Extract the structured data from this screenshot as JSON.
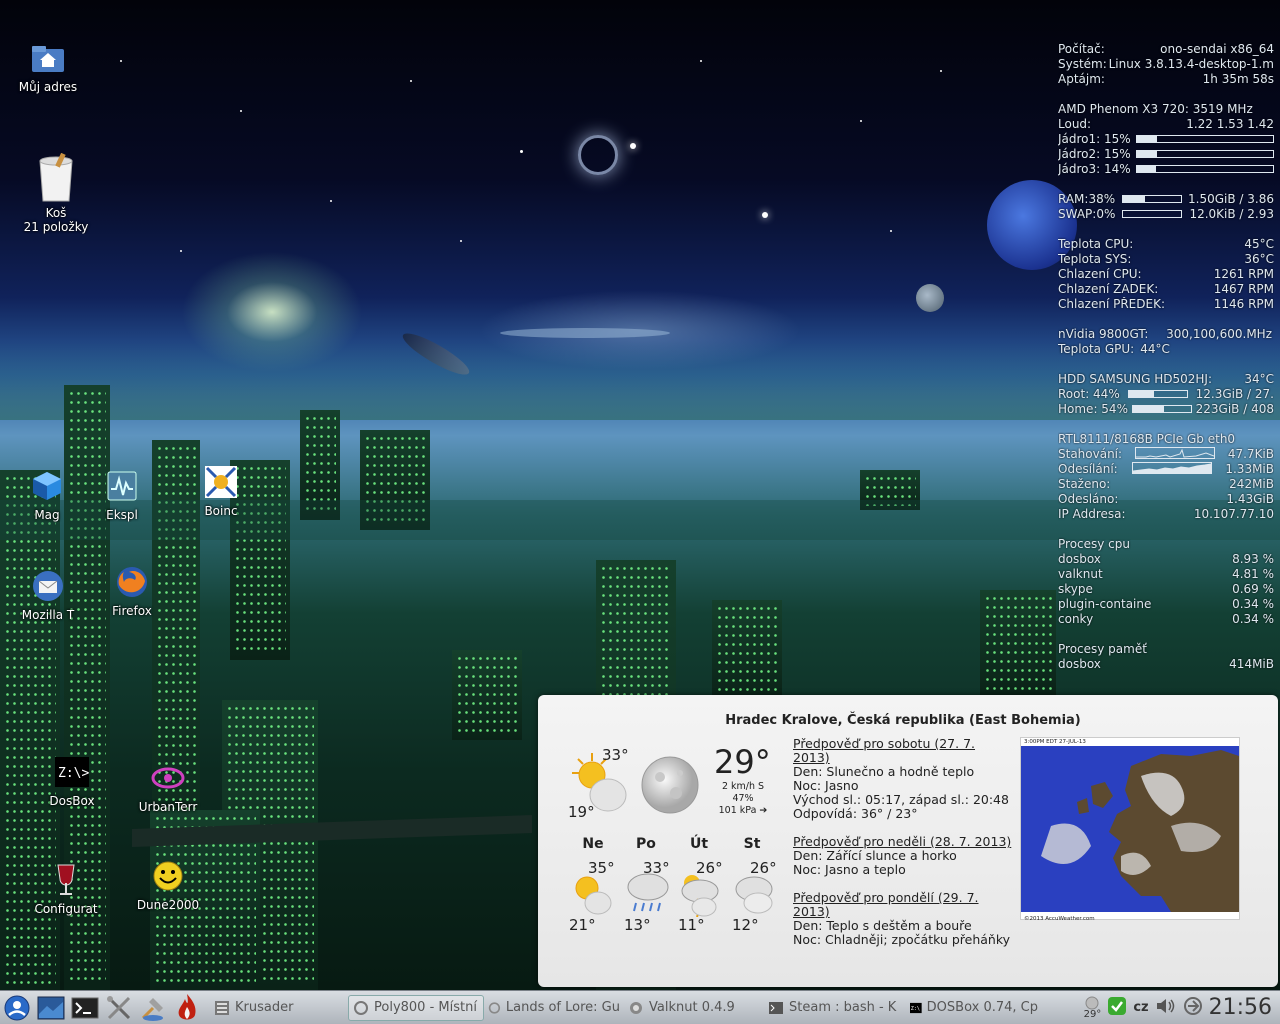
{
  "desktop": {
    "icons": [
      {
        "label": "Můj adres",
        "icon": "home-folder-icon"
      },
      {
        "label": "Koš",
        "sublabel": "21 položky",
        "icon": "trash-icon"
      },
      {
        "label": "Mag",
        "icon": "cube-icon"
      },
      {
        "label": "Ekspl",
        "icon": "monitor-icon"
      },
      {
        "label": "Boinc",
        "icon": "boinc-icon"
      },
      {
        "label": "Mozilla T",
        "icon": "thunderbird-icon"
      },
      {
        "label": "Firefox",
        "icon": "firefox-icon"
      },
      {
        "label": "DosBox",
        "icon": "dosbox-icon"
      },
      {
        "label": "UrbanTerr",
        "icon": "urbanterror-icon"
      },
      {
        "label": "Configurat",
        "icon": "wine-icon"
      },
      {
        "label": "Dune2000",
        "icon": "smiley-icon"
      }
    ]
  },
  "conky": {
    "sys": [
      {
        "l": "Počítač:",
        "r": "ono-sendai x86_64"
      },
      {
        "l": "Systém:",
        "r": "Linux 3.8.13.4-desktop-1.m"
      },
      {
        "l": "Aptájm:",
        "r": "1h 35m 58s"
      }
    ],
    "cpu_name": "AMD Phenom X3 720: 3519 MHz",
    "load": {
      "l": "Loud:",
      "r": "1.22 1.53 1.42"
    },
    "cores": [
      {
        "l": "Jádro1: 15%",
        "v": 0.15
      },
      {
        "l": "Jádro2: 15%",
        "v": 0.15
      },
      {
        "l": "Jádro3: 14%",
        "v": 0.14
      }
    ],
    "mem": [
      {
        "l": "RAM:38%",
        "v": 0.38,
        "r": "1.50GiB / 3.86"
      },
      {
        "l": "SWAP:0%",
        "v": 0.0,
        "r": "12.0KiB / 2.93"
      }
    ],
    "temps": [
      {
        "l": "Teplota CPU:",
        "r": "45°C"
      },
      {
        "l": "Teplota SYS:",
        "r": "36°C"
      },
      {
        "l": "Chlazení CPU:",
        "r": "1261 RPM"
      },
      {
        "l": "Chlazení ZADEK:",
        "r": "1467 RPM"
      },
      {
        "l": "Chlazení PŘEDEK:",
        "r": "1146 RPM"
      }
    ],
    "gpu": [
      {
        "l": "nVidia 9800GT:",
        "r": "300,100,600.MHz"
      },
      {
        "l": "Teplota GPU:",
        "r": "44°C"
      }
    ],
    "hdd": {
      "l": "HDD SAMSUNG HD502HJ:",
      "r": "34°C"
    },
    "disks": [
      {
        "l": "Root: 44%",
        "v": 0.44,
        "r": "12.3GiB / 27."
      },
      {
        "l": "Home: 54%",
        "v": 0.54,
        "r": "223GiB / 408"
      }
    ],
    "net_name": "RTL8111/8168B PCIe Gb eth0",
    "net_rates": [
      {
        "l": "Stahování:",
        "r": "47.7KiB"
      },
      {
        "l": "Odesílání:",
        "r": "1.33MiB"
      }
    ],
    "net_totals": [
      {
        "l": "Staženo:",
        "r": "242MiB"
      },
      {
        "l": "Odesláno:",
        "r": "1.43GiB"
      },
      {
        "l": "IP Addresa:",
        "r": "10.107.77.10"
      }
    ],
    "proc_cpu_title": "Procesy cpu",
    "proc_cpu": [
      {
        "l": "dosbox",
        "r": "8.93 %"
      },
      {
        "l": "valknut",
        "r": "4.81 %"
      },
      {
        "l": "skype",
        "r": "0.69 %"
      },
      {
        "l": "plugin-containe",
        "r": "0.34 %"
      },
      {
        "l": "conky",
        "r": "0.34 %"
      }
    ],
    "proc_mem_title": "Procesy paměť",
    "proc_mem": [
      {
        "l": "dosbox",
        "r": "414MiB"
      }
    ]
  },
  "weather": {
    "title": "Hradec Kralove, Česká republika (East Bohemia)",
    "today": {
      "hi": "33°",
      "lo": "19°",
      "icon": "sun-cloud-icon"
    },
    "now": {
      "temp": "29°",
      "wind": "2 km/h S",
      "humidity": "47%",
      "pressure": "101 kPa ➔",
      "icon": "moon-icon"
    },
    "days": [
      {
        "name": "Ne",
        "hi": "35°",
        "lo": "21°",
        "icon": "sun-cloud-icon"
      },
      {
        "name": "Po",
        "hi": "33°",
        "lo": "13°",
        "icon": "rain-cloud-icon"
      },
      {
        "name": "Út",
        "hi": "26°",
        "lo": "11°",
        "icon": "storm-cloud-icon"
      },
      {
        "name": "St",
        "hi": "26°",
        "lo": "12°",
        "icon": "cloud-icon"
      }
    ],
    "forecasts": [
      {
        "title": "Předpověď pro sobotu (27. 7. 2013)",
        "lines": [
          "Den: Slunečno a hodně teplo",
          "Noc: Jasno",
          "Východ sl.: 05:17, západ sl.: 20:48",
          "Odpovídá: 36° / 23°"
        ]
      },
      {
        "title": "Předpověď pro neděli (28. 7. 2013)",
        "lines": [
          "Den: Zářící slunce a horko",
          "Noc: Jasno a teplo"
        ]
      },
      {
        "title": "Předpověď pro pondělí (29. 7. 2013)",
        "lines": [
          "Den: Teplo s deštěm a bouře",
          "Noc: Chladněji; zpočátku přeháňky"
        ]
      }
    ],
    "map": {
      "header": "3:00PM EDT 27-JUL-13",
      "footer": "©2013 AccuWeather.com"
    }
  },
  "taskbar": {
    "tasks": [
      {
        "label": "Krusader",
        "icon": "krusader-icon",
        "active": false
      },
      {
        "label": "Poly800 - Místní",
        "icon": "poly-icon",
        "active": true
      },
      {
        "label": "Lands of Lore: Gu",
        "icon": "game-icon",
        "active": false
      },
      {
        "label": "Valknut 0.4.9",
        "icon": "valknut-icon",
        "active": false
      },
      {
        "label": "Steam : bash - K",
        "icon": "terminal-icon",
        "active": false
      },
      {
        "label": "DOSBox 0.74, Cp",
        "icon": "dosbox-icon",
        "active": false
      }
    ],
    "tray_temp": "29°",
    "keyboard": "cz",
    "clock": "21:56"
  },
  "colors": {
    "conky_text": "#dfe8f0",
    "panel_bg": "#efefef",
    "taskbar_bg": "#c5cad0"
  }
}
